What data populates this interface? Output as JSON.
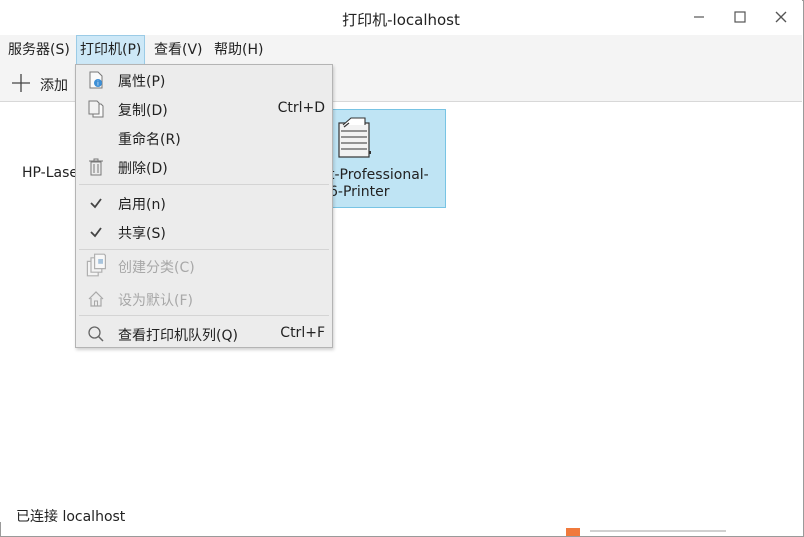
{
  "window": {
    "title": "打印机-localhost"
  },
  "menubar": {
    "items": [
      {
        "label": "服务器(S)"
      },
      {
        "label": "打印机(P)"
      },
      {
        "label": "查看(V)"
      },
      {
        "label": "帮助(H)"
      }
    ]
  },
  "toolbar": {
    "add_label": "添加"
  },
  "printers": [
    {
      "label": "HP-Lase"
    },
    {
      "label_line1": "t-Professional-",
      "label_line2": "6-Printer"
    }
  ],
  "printer_menu": {
    "items": [
      {
        "label": "属性(P)",
        "shortcut": "",
        "icon": "properties-icon",
        "enabled": true
      },
      {
        "label": "复制(D)",
        "shortcut": "Ctrl+D",
        "icon": "copy-icon",
        "enabled": true
      },
      {
        "label": "重命名(R)",
        "shortcut": "",
        "icon": "",
        "enabled": true
      },
      {
        "label": "删除(D)",
        "shortcut": "",
        "icon": "trash-icon",
        "enabled": true
      },
      {
        "label": "启用(n)",
        "shortcut": "",
        "icon": "check-icon",
        "enabled": true,
        "checked": true
      },
      {
        "label": "共享(S)",
        "shortcut": "",
        "icon": "check-icon",
        "enabled": true,
        "checked": true
      },
      {
        "label": "创建分类(C)",
        "shortcut": "",
        "icon": "create-class-icon",
        "enabled": false
      },
      {
        "label": "设为默认(F)",
        "shortcut": "",
        "icon": "home-icon",
        "enabled": false
      },
      {
        "label": "查看打印机队列(Q)",
        "shortcut": "Ctrl+F",
        "icon": "search-icon",
        "enabled": true
      }
    ]
  },
  "status": {
    "text": "已连接 localhost"
  }
}
